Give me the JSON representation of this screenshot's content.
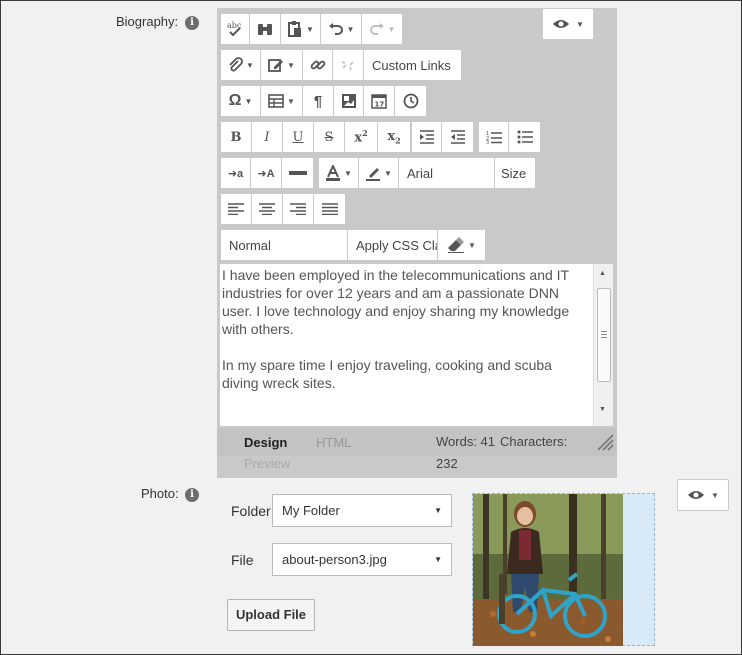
{
  "biography": {
    "label": "Biography:",
    "info_glyph": "i",
    "toolbar": {
      "custom_links": "Custom Links",
      "font_name": "Arial",
      "font_size": "Size",
      "paragraph_style": "Normal",
      "css_class": "Apply CSS Cla"
    },
    "content": [
      "I have been employed in the telecommunications and IT industries for over 12 years and am a passionate DNN user. I love technology and  enjoy sharing my knowledge with others.",
      "In my spare time I enjoy traveling, cooking and scuba diving wreck sites."
    ],
    "footer": {
      "modes": [
        "Design",
        "HTML",
        "Preview"
      ],
      "words_label": "Words: 41",
      "characters_label": "Characters:",
      "characters_value": "232"
    }
  },
  "photo": {
    "label": "Photo:",
    "info_glyph": "i",
    "folder_label": "Folder",
    "folder_value": "My Folder",
    "file_label": "File",
    "file_value": "about-person3.jpg",
    "upload_label": "Upload File"
  },
  "colors": {
    "toolbar_bg": "#c9c9c9",
    "page_bg": "#f1f1f1",
    "dropzone": "#d8eaf8"
  },
  "icons": [
    "eye-icon",
    "spellcheck-icon",
    "binoculars-icon",
    "paste-icon",
    "undo-icon",
    "redo-icon",
    "paperclip-icon",
    "edit-icon",
    "link-icon",
    "unlink-icon",
    "omega-icon",
    "table-icon",
    "pilcrow-icon",
    "image-icon",
    "calendar-icon",
    "clock-icon",
    "bold-icon",
    "italic-icon",
    "underline-icon",
    "strikethrough-icon",
    "superscript-icon",
    "subscript-icon",
    "indent-icon",
    "outdent-icon",
    "numbered-list-icon",
    "bullet-list-icon",
    "font-color-icon",
    "highlight-icon",
    "horizontal-rule-icon",
    "eraser-icon",
    "align-left-icon",
    "align-center-icon",
    "align-right-icon",
    "justify-icon",
    "resize-grip-icon"
  ]
}
